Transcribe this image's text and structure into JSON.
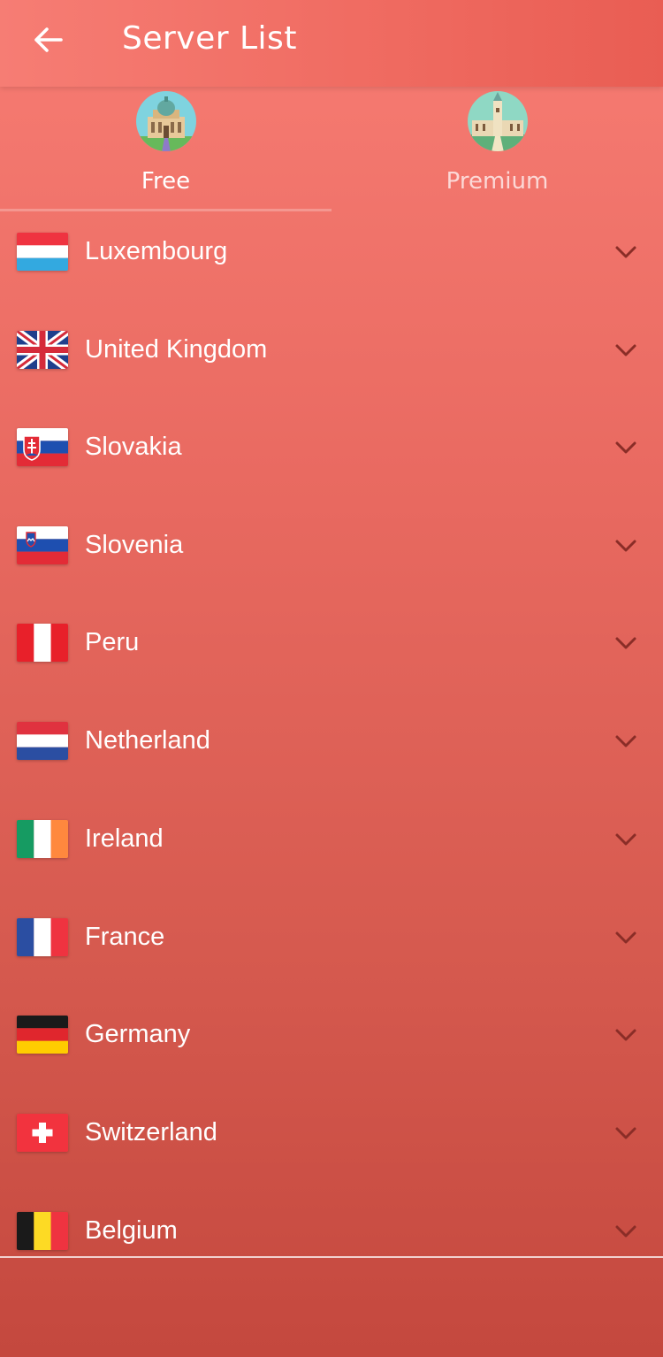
{
  "appbar": {
    "title": "Server List",
    "back_icon": "arrow-left-icon"
  },
  "tabs": [
    {
      "label": "Free",
      "icon": "landmark-dome-icon",
      "selected": true
    },
    {
      "label": "Premium",
      "icon": "landmark-tower-icon",
      "selected": false
    }
  ],
  "servers": [
    {
      "country": "Luxembourg",
      "flag": "luxembourg-flag-icon"
    },
    {
      "country": "United Kingdom",
      "flag": "uk-flag-icon"
    },
    {
      "country": "Slovakia",
      "flag": "slovakia-flag-icon"
    },
    {
      "country": "Slovenia",
      "flag": "slovenia-flag-icon"
    },
    {
      "country": "Peru",
      "flag": "peru-flag-icon"
    },
    {
      "country": "Netherland",
      "flag": "netherlands-flag-icon"
    },
    {
      "country": "Ireland",
      "flag": "ireland-flag-icon"
    },
    {
      "country": "France",
      "flag": "france-flag-icon"
    },
    {
      "country": "Germany",
      "flag": "germany-flag-icon"
    },
    {
      "country": "Switzerland",
      "flag": "switzerland-flag-icon"
    },
    {
      "country": "Belgium",
      "flag": "belgium-flag-icon"
    }
  ],
  "colors": {
    "accent": "#f26d63",
    "text": "#ffffff",
    "chevron": "#8a2d27"
  }
}
